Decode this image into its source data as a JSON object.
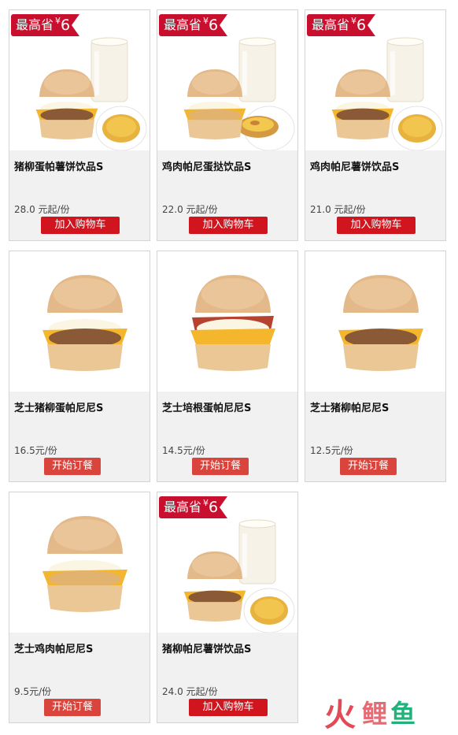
{
  "products": [
    {
      "name": "猪柳蛋帕薯饼饮品S",
      "price": "28.0 元起/份",
      "button": "加入购物车",
      "badge": {
        "text": "最高省",
        "yen": "¥",
        "amount": "6"
      },
      "food": "combo-hashbrown"
    },
    {
      "name": "鸡肉帕尼蛋挞饮品S",
      "price": "22.0 元起/份",
      "button": "加入购物车",
      "badge": {
        "text": "最高省",
        "yen": "¥",
        "amount": "6"
      },
      "food": "combo-tart"
    },
    {
      "name": "鸡肉帕尼薯饼饮品S",
      "price": "21.0 元起/份",
      "button": "加入购物车",
      "badge": {
        "text": "最高省",
        "yen": "¥",
        "amount": "6"
      },
      "food": "combo-hashbrown"
    },
    {
      "name": "芝士猪柳蛋帕尼尼S",
      "price": "16.5元/份",
      "button": "开始订餐",
      "badge": null,
      "food": "sandwich-egg"
    },
    {
      "name": "芝士培根蛋帕尼尼S",
      "price": "14.5元/份",
      "button": "开始订餐",
      "badge": null,
      "food": "sandwich-bacon"
    },
    {
      "name": "芝士猪柳帕尼尼S",
      "price": "12.5元/份",
      "button": "开始订餐",
      "badge": null,
      "food": "sandwich-pork"
    },
    {
      "name": "芝士鸡肉帕尼尼S",
      "price": "9.5元/份",
      "button": "开始订餐",
      "badge": null,
      "food": "sandwich-chicken"
    },
    {
      "name": "猪柳帕尼薯饼饮品S",
      "price": "24.0 元起/份",
      "button": "加入购物车",
      "badge": {
        "text": "最高省",
        "yen": "¥",
        "amount": "6"
      },
      "food": "combo-hashbrown-pork"
    }
  ],
  "watermark": {
    "char1": "火",
    "char2": "鲤",
    "char3": "鱼"
  },
  "colors": {
    "badge": "#c8102e",
    "button": "#d0151e",
    "accent_green": "#20b27a"
  }
}
